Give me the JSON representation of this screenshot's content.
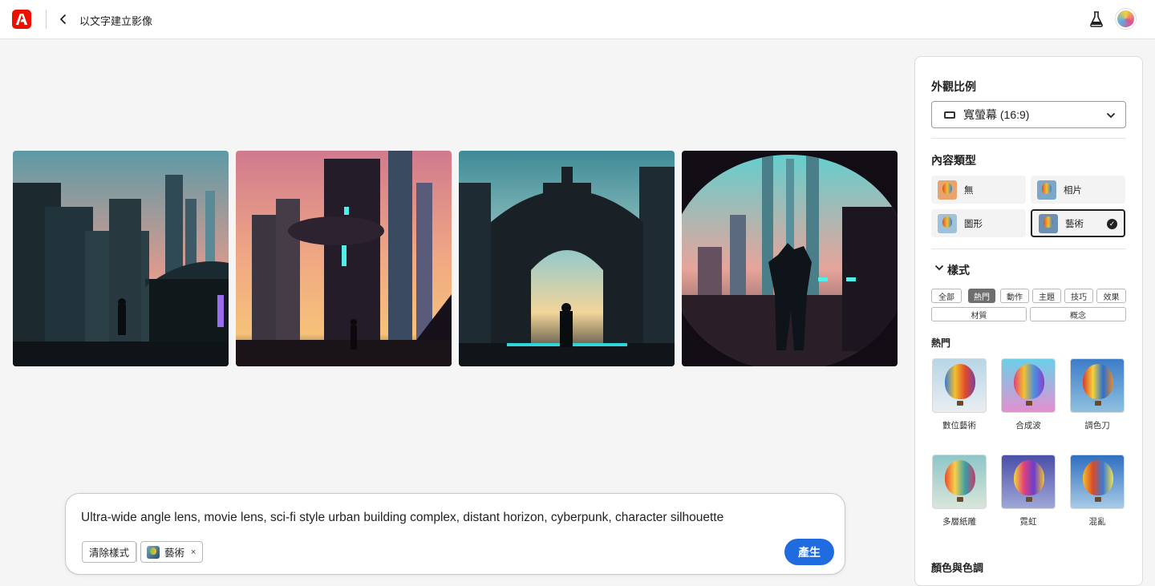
{
  "header": {
    "title": "以文字建立影像"
  },
  "prompt": {
    "text": "Ultra-wide angle lens, movie lens, sci-fi style urban building complex, distant horizon, cyberpunk, character silhouette",
    "clear_label": "清除樣式",
    "style_chip_label": "藝術",
    "style_chip_remove": "×",
    "generate_label": "產生"
  },
  "panel": {
    "aspect_title": "外觀比例",
    "aspect_value": "寬螢幕 (16:9)",
    "content_type_title": "內容類型",
    "content_types": [
      {
        "label": "無"
      },
      {
        "label": "相片"
      },
      {
        "label": "圖形"
      },
      {
        "label": "藝術"
      }
    ],
    "selected_content_type": "藝術",
    "styles_title": "樣式",
    "style_tabs": [
      "全部",
      "熱門",
      "動作",
      "主題",
      "技巧",
      "效果",
      "材質",
      "概念"
    ],
    "active_style_tab": "熱門",
    "popular_title": "熱門",
    "popular_styles": [
      {
        "label": "數位藝術"
      },
      {
        "label": "合成波"
      },
      {
        "label": "調色刀"
      },
      {
        "label": "多層紙雕"
      },
      {
        "label": "霓虹"
      },
      {
        "label": "混亂"
      }
    ],
    "color_title": "顏色與色調"
  },
  "colors": {
    "accent": "#1f6ce0",
    "brand": "#eb1000"
  },
  "icons": [
    "adobe-logo-icon",
    "chevron-left-icon",
    "flask-icon",
    "avatar",
    "widescreen-icon",
    "chevron-down-icon",
    "checkmark-icon",
    "close-icon"
  ]
}
